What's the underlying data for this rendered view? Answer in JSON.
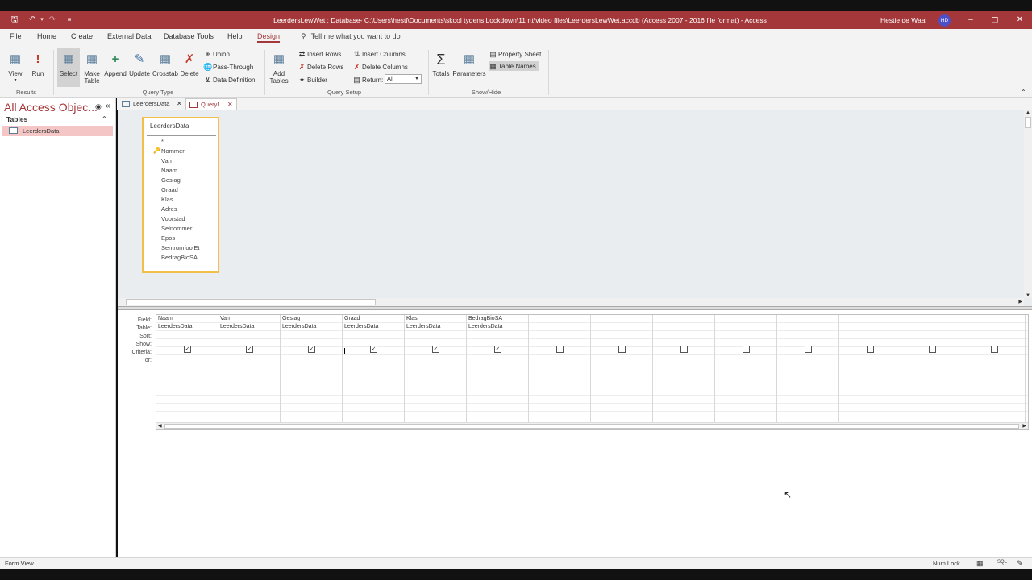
{
  "titlebar": {
    "title": "LeerdersLewWet : Database- C:\\Users\\hesti\\Documents\\skool tydens Lockdown\\11 rtt\\video files\\LeerdersLewWet.accdb (Access 2007 - 2016 file format)  -  Access",
    "user": "Hestie de Waal",
    "initials": "HD"
  },
  "menu": {
    "tabs": [
      "File",
      "Home",
      "Create",
      "External Data",
      "Database Tools",
      "Help",
      "Design"
    ],
    "tell_me": "Tell me what you want to do"
  },
  "ribbon": {
    "results": {
      "view": "View",
      "run": "Run",
      "label": "Results"
    },
    "query_type": {
      "select": "Select",
      "make_table_1": "Make",
      "make_table_2": "Table",
      "append": "Append",
      "update": "Update",
      "crosstab": "Crosstab",
      "delete": "Delete",
      "union": "Union",
      "pass_through": "Pass-Through",
      "data_definition": "Data Definition",
      "label": "Query Type"
    },
    "query_setup": {
      "add_tables_1": "Add",
      "add_tables_2": "Tables",
      "insert_rows": "Insert Rows",
      "delete_rows": "Delete Rows",
      "builder": "Builder",
      "insert_columns": "Insert Columns",
      "delete_columns": "Delete Columns",
      "return_label": "Return:",
      "return_value": "All",
      "label": "Query Setup"
    },
    "show_hide": {
      "totals": "Totals",
      "parameters": "Parameters",
      "property_sheet": "Property Sheet",
      "table_names": "Table Names",
      "label": "Show/Hide"
    }
  },
  "nav": {
    "title": "All Access Objec...",
    "section": "Tables",
    "items": [
      "LeerdersData"
    ]
  },
  "doctabs": [
    "LeerdersData",
    "Query1"
  ],
  "table_box": {
    "name": "LeerdersData",
    "fields": [
      "*",
      "Nommer",
      "Van",
      "Naam",
      "Geslag",
      "Graad",
      "Klas",
      "Adres",
      "Voorstad",
      "Selnommer",
      "Epos",
      "SentrumfooiEt",
      "BedragBioSA"
    ]
  },
  "grid": {
    "row_labels": [
      "Field:",
      "Table:",
      "Sort:",
      "Show:",
      "Criteria:",
      "or:"
    ],
    "columns": [
      {
        "field": "Naam",
        "table": "LeerdersData",
        "show": true
      },
      {
        "field": "Van",
        "table": "LeerdersData",
        "show": true
      },
      {
        "field": "Geslag",
        "table": "LeerdersData",
        "show": true
      },
      {
        "field": "Graad",
        "table": "LeerdersData",
        "show": true
      },
      {
        "field": "Klas",
        "table": "LeerdersData",
        "show": true
      },
      {
        "field": "BedragBioSA",
        "table": "LeerdersData",
        "show": true
      },
      {
        "field": "",
        "table": "",
        "show": false
      },
      {
        "field": "",
        "table": "",
        "show": false
      },
      {
        "field": "",
        "table": "",
        "show": false
      },
      {
        "field": "",
        "table": "",
        "show": false
      },
      {
        "field": "",
        "table": "",
        "show": false
      },
      {
        "field": "",
        "table": "",
        "show": false
      },
      {
        "field": "",
        "table": "",
        "show": false
      },
      {
        "field": "",
        "table": "",
        "show": false
      }
    ]
  },
  "status": {
    "left": "Form View",
    "num_lock": "Num Lock"
  }
}
